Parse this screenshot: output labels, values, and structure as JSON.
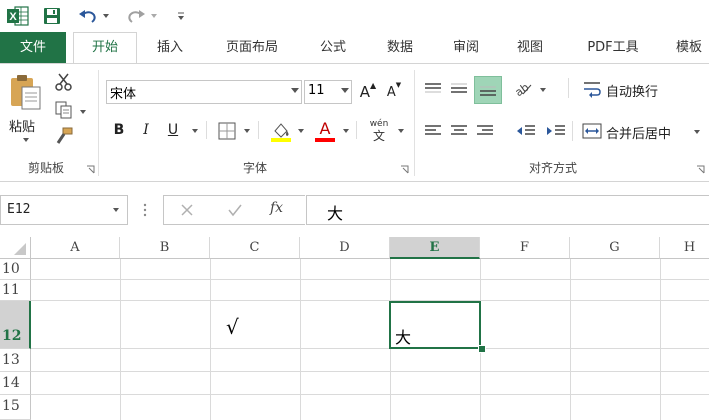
{
  "quick_access": {
    "app_icon": "excel-logo",
    "save_icon": "save-icon",
    "undo_icon": "undo-icon",
    "redo_icon": "redo-icon",
    "customize_icon": "customize-qat-icon"
  },
  "tabs": [
    {
      "label": "文件"
    },
    {
      "label": "开始"
    },
    {
      "label": "插入"
    },
    {
      "label": "页面布局"
    },
    {
      "label": "公式"
    },
    {
      "label": "数据"
    },
    {
      "label": "审阅"
    },
    {
      "label": "视图"
    },
    {
      "label": "PDF工具"
    },
    {
      "label": "模板"
    }
  ],
  "ribbon": {
    "clipboard": {
      "paste_label": "粘贴",
      "group_label": "剪贴板"
    },
    "font": {
      "font_name": "宋体",
      "font_size": "11",
      "bold": "B",
      "italic": "I",
      "underline": "U",
      "grow": "A",
      "shrink": "A",
      "phonetic": "wén",
      "phonetic_char": "文",
      "font_color_letter": "A",
      "group_label": "字体",
      "fill_color": "#ffff00",
      "font_color": "#ff0000"
    },
    "alignment": {
      "wrap_text": "自动换行",
      "merge_center": "合并后居中",
      "group_label": "对齐方式"
    }
  },
  "formula_bar": {
    "name_box": "E12",
    "fx": "fx",
    "content": "大"
  },
  "grid": {
    "columns": [
      "A",
      "B",
      "C",
      "D",
      "E",
      "F",
      "G",
      "H"
    ],
    "selected_column": "E",
    "rows": [
      "10",
      "11",
      "12",
      "13",
      "14",
      "15"
    ],
    "selected_row": "12",
    "cells": {
      "C12": "√",
      "E12": "大"
    }
  },
  "colors": {
    "accent": "#217346",
    "header_selected": "#d2d2d2"
  }
}
